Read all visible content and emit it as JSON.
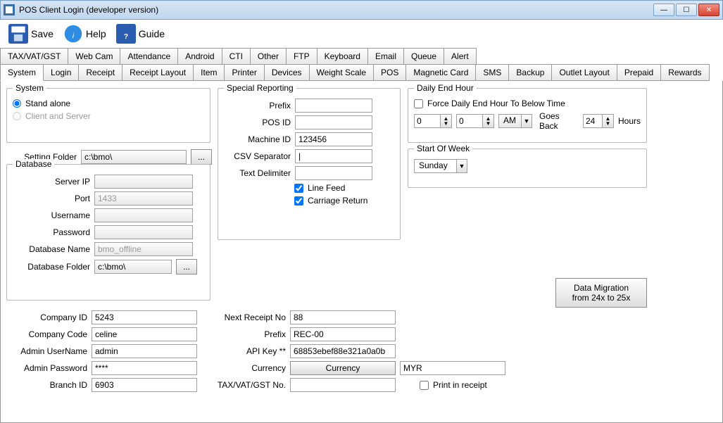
{
  "window": {
    "title": "POS Client Login (developer version)"
  },
  "toolbar": {
    "save": "Save",
    "help": "Help",
    "guide": "Guide"
  },
  "tab_row1": [
    "TAX/VAT/GST",
    "Web Cam",
    "Attendance",
    "Android",
    "CTI",
    "Other",
    "FTP",
    "Keyboard",
    "Email",
    "Queue",
    "Alert"
  ],
  "tab_row2": [
    "System",
    "Login",
    "Receipt",
    "Receipt Layout",
    "Item",
    "Printer",
    "Devices",
    "Weight Scale",
    "POS",
    "Magnetic Card",
    "SMS",
    "Backup",
    "Outlet Layout",
    "Prepaid",
    "Rewards"
  ],
  "system": {
    "title": "System",
    "stand_alone": "Stand alone",
    "client_server": "Client and Server",
    "setting_folder_lbl": "Setting Folder",
    "setting_folder_val": "c:\\bmo\\"
  },
  "database": {
    "title": "Database",
    "server_ip_lbl": "Server IP",
    "server_ip_val": "",
    "port_lbl": "Port",
    "port_val": "1433",
    "username_lbl": "Username",
    "username_val": "",
    "password_lbl": "Password",
    "password_val": "",
    "dbname_lbl": "Database Name",
    "dbname_val": "bmo_offline",
    "dbfolder_lbl": "Database Folder",
    "dbfolder_val": "c:\\bmo\\"
  },
  "special": {
    "title": "Special Reporting",
    "prefix_lbl": "Prefix",
    "prefix_val": "",
    "posid_lbl": "POS ID",
    "posid_val": "",
    "machineid_lbl": "Machine ID",
    "machineid_val": "123456",
    "csvsep_lbl": "CSV Separator",
    "csvsep_val": "|",
    "textdelim_lbl": "Text Delimiter",
    "textdelim_val": "",
    "linefeed_lbl": "Line Feed",
    "cr_lbl": "Carriage Return"
  },
  "dailyend": {
    "title": "Daily End Hour",
    "force_lbl": "Force Daily End Hour To Below Time",
    "hour": "0",
    "minute": "0",
    "ampm": "AM",
    "goesback_lbl": "Goes Back",
    "goesback_val": "24",
    "hours_lbl": "Hours"
  },
  "startweek": {
    "title": "Start Of Week",
    "value": "Sunday"
  },
  "migration": {
    "line1": "Data Migration",
    "line2": "from 24x to 25x"
  },
  "bottom_left": {
    "company_id_lbl": "Company ID",
    "company_id_val": "5243",
    "company_code_lbl": "Company Code",
    "company_code_val": "celine",
    "admin_user_lbl": "Admin UserName",
    "admin_user_val": "admin",
    "admin_pass_lbl": "Admin Password",
    "admin_pass_val": "****",
    "branch_id_lbl": "Branch ID",
    "branch_id_val": "6903"
  },
  "bottom_mid": {
    "next_receipt_lbl": "Next Receipt No",
    "next_receipt_val": "88",
    "prefix_lbl": "Prefix",
    "prefix_val": "REC-00",
    "apikey_lbl": "API Key **",
    "apikey_val": "68853ebef88e321a0a0b",
    "currency_lbl": "Currency",
    "currency_btn": "Currency",
    "currency_val": "MYR",
    "tax_lbl": "TAX/VAT/GST No.",
    "tax_val": "",
    "print_receipt_lbl": "Print in receipt"
  }
}
